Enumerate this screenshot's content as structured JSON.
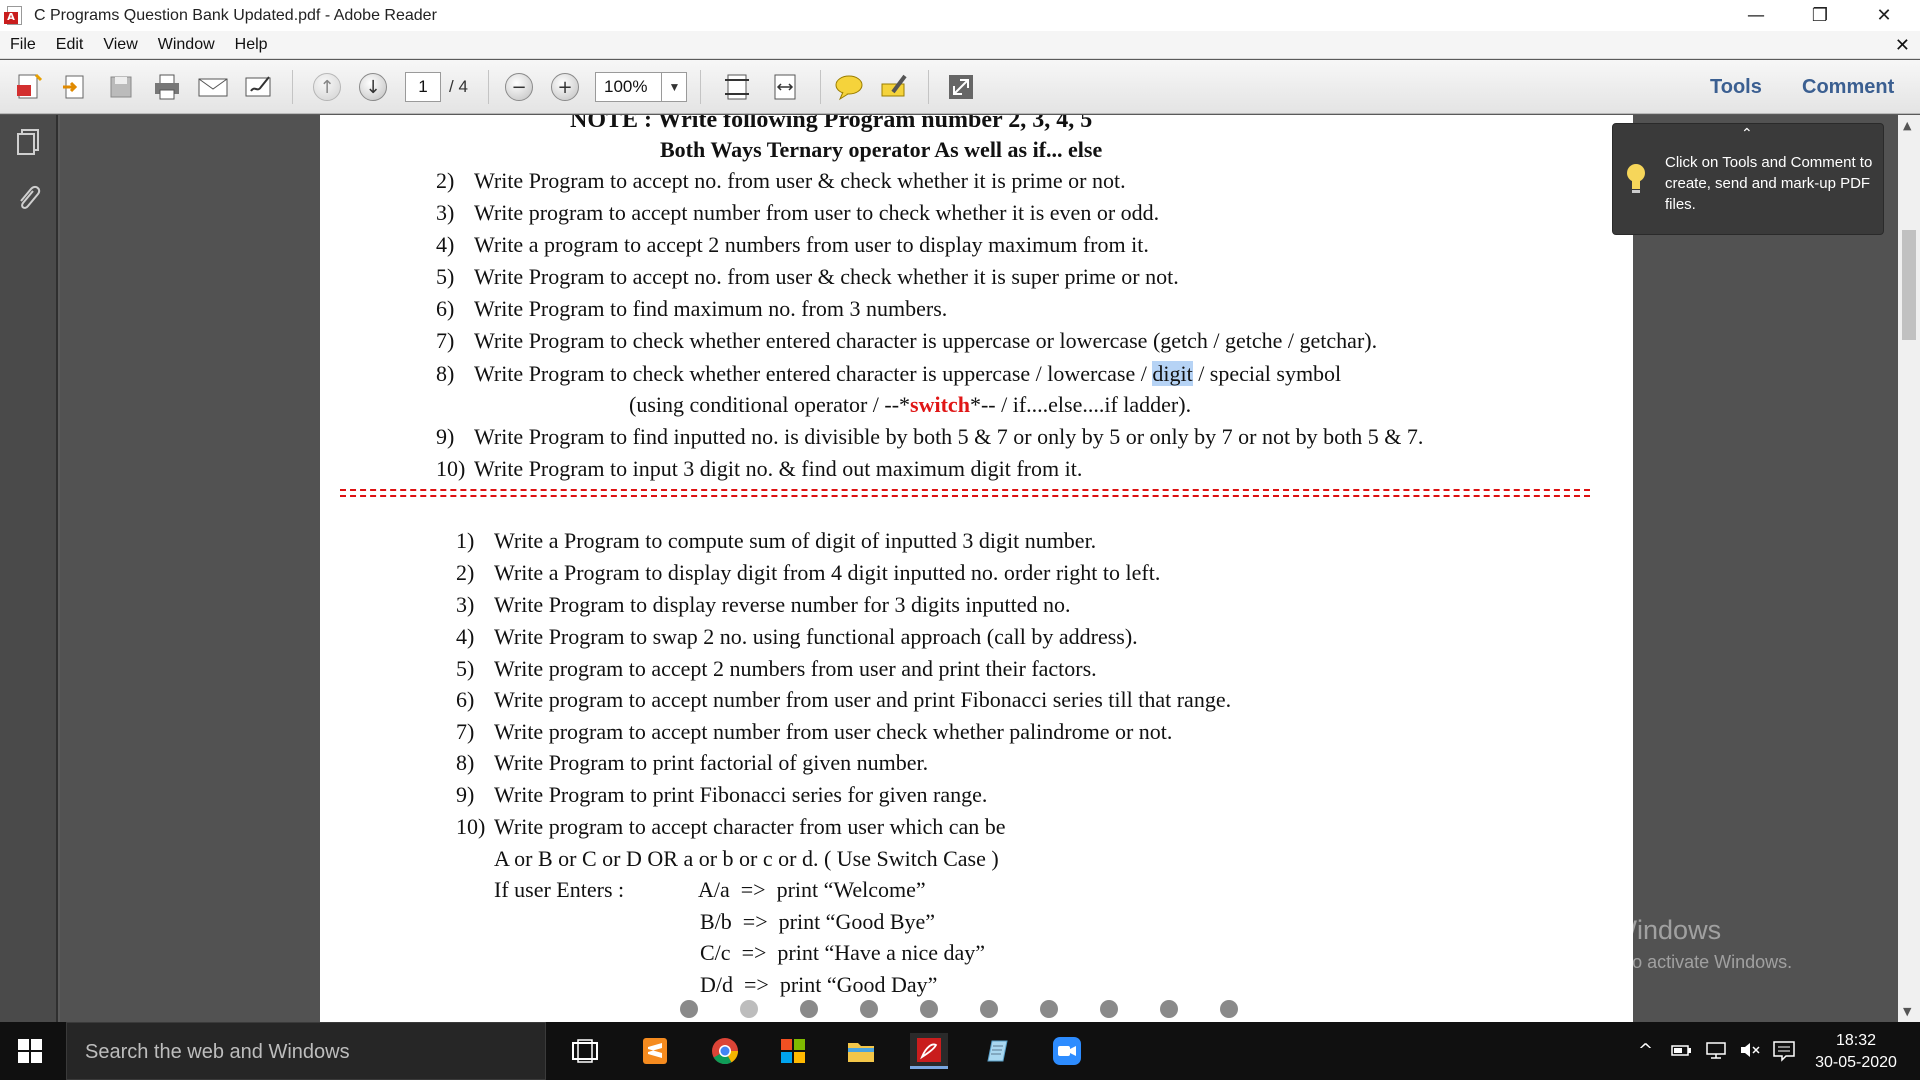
{
  "window": {
    "title": "C Programs Question Bank Updated.pdf - Adobe Reader",
    "minimize": "—",
    "maximize": "❐",
    "close": "✕"
  },
  "menu": {
    "items": [
      "File",
      "Edit",
      "View",
      "Window",
      "Help"
    ],
    "close": "✕"
  },
  "toolbar": {
    "page_current": "1",
    "page_total": "/ 4",
    "zoom": "100%",
    "tools_label": "Tools",
    "comment_label": "Comment",
    "icons": [
      "create-pdf-icon",
      "export-icon",
      "save-icon",
      "print-icon",
      "email-icon",
      "sign-icon",
      "previous-page-icon",
      "next-page-icon",
      "zoom-out-icon",
      "zoom-in-icon",
      "fit-page-icon",
      "fit-width-icon",
      "sticky-note-icon",
      "highlight-icon",
      "fullscreen-icon"
    ]
  },
  "tooltip": {
    "text": "Click on Tools and Comment to create, send and mark-up PDF files."
  },
  "document": {
    "note_heading": "NOTE : Write following Program number 2, 3, 4, 5",
    "note_subheading": "Both Ways Ternary operator  As well as  if... else",
    "list1": [
      {
        "num": "2)",
        "text": "Write Program to accept no. from user & check whether it is prime or not."
      },
      {
        "num": "3)",
        "text": "Write program to accept number from user to check whether it is even or odd."
      },
      {
        "num": "4)",
        "text": "Write a program to accept 2 numbers from user to display maximum from it."
      },
      {
        "num": "5)",
        "text": "Write Program to accept no. from user & check whether it is super prime or not."
      },
      {
        "num": "6)",
        "text": "Write Program to find maximum no. from 3 numbers."
      },
      {
        "num": "7)",
        "text": "Write Program to check whether entered character is uppercase or lowercase (getch / getche / getchar)."
      }
    ],
    "item8": {
      "num": "8)",
      "text_before": "Write Program to check whether entered character is uppercase / lowercase / ",
      "highlight": "digit",
      "text_after": " / special symbol",
      "line2_before": "(using conditional operator / --*",
      "line2_red": "switch",
      "line2_after": "*-- / if....else....if ladder)."
    },
    "list1b": [
      {
        "num": "9)",
        "text": "Write Program to find inputted no. is divisible by both 5 & 7 or only by 5 or only by 7 or not by both 5 & 7."
      },
      {
        "num": "10)",
        "text": "Write Program to input 3 digit no. & find out maximum digit from it."
      }
    ],
    "list2": [
      {
        "num": "1)",
        "text": "Write a Program to compute sum of digit of inputted 3 digit number."
      },
      {
        "num": "2)",
        "text": "Write a Program to display digit from 4 digit inputted no. order right to left."
      },
      {
        "num": "3)",
        "text": "Write Program to display reverse number for 3 digits inputted no."
      },
      {
        "num": "4)",
        "text": "Write Program to swap 2 no. using functional approach (call by address)."
      },
      {
        "num": "5)",
        "text": "Write program to accept 2 numbers from user and print their factors."
      },
      {
        "num": "6)",
        "text": "Write program to accept number from user and print Fibonacci series till that range."
      },
      {
        "num": "7)",
        "text": "Write program to accept number from user check whether palindrome or not."
      },
      {
        "num": "8)",
        "text": "Write Program to print factorial of given number."
      },
      {
        "num": "9)",
        "text": "Write Program to print Fibonacci series for given range."
      },
      {
        "num": "10)",
        "text": "Write program to accept character from user which can be"
      }
    ],
    "item10_line2": "A or B or C or D OR a or b or c or d. ( Use Switch Case )",
    "if_user_enters": "If user Enters :",
    "cases": [
      {
        "key": "A/a",
        "arrow": "=>",
        "text": "print “Welcome”"
      },
      {
        "key": "B/b",
        "arrow": "=>",
        "text": "print “Good Bye”"
      },
      {
        "key": "C/c",
        "arrow": "=>",
        "text": "print “Have a nice day”"
      },
      {
        "key": "D/d",
        "arrow": "=>",
        "text": "print “Good Day”"
      }
    ]
  },
  "activate": {
    "line1": "Activate Windows",
    "line2": "Go to Settings to activate Windows."
  },
  "taskbar": {
    "search_placeholder": "Search the web and Windows",
    "time": "18:32",
    "date": "30-05-2020"
  }
}
